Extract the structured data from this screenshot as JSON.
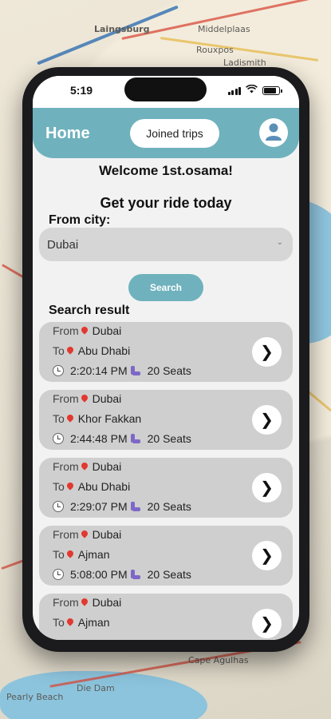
{
  "status_bar": {
    "time": "5:19"
  },
  "header": {
    "title": "Home",
    "joined_trips_label": "Joined trips"
  },
  "welcome_text": "Welcome 1st.osama!",
  "subtitle": "Get your ride today",
  "from_city": {
    "label": "From city:",
    "selected": "Dubai",
    "chevron": "⌄"
  },
  "search_button": "Search",
  "results_label": "Search result",
  "trip_labels": {
    "from": "From",
    "to": "To"
  },
  "trips": [
    {
      "from": "Dubai",
      "to": "Abu Dhabi",
      "time": "2:20:14 PM",
      "seats": "20 Seats"
    },
    {
      "from": "Dubai",
      "to": "Khor Fakkan",
      "time": "2:44:48 PM",
      "seats": "20 Seats"
    },
    {
      "from": "Dubai",
      "to": "Abu Dhabi",
      "time": "2:29:07 PM",
      "seats": "20 Seats"
    },
    {
      "from": "Dubai",
      "to": "Ajman",
      "time": "5:08:00 PM",
      "seats": "20 Seats"
    },
    {
      "from": "Dubai",
      "to": "Ajman"
    }
  ],
  "go_glyph": "❯",
  "map_labels": [
    "Laingsburg",
    "Middelplaas",
    "Rouxpos",
    "Ladismith",
    "Die Dam",
    "Cape Agulhas",
    "Pearly Beach"
  ],
  "colors": {
    "accent": "#6fb2bd",
    "card": "#cfcfcf",
    "pin": "#e2382f",
    "seat_icon": "#7d68c8"
  },
  "icons": [
    "signal-icon",
    "wifi-icon",
    "battery-icon",
    "avatar-icon",
    "location-pin-icon",
    "clock-icon",
    "seat-icon",
    "chevron-right-icon",
    "chevron-down-icon"
  ]
}
